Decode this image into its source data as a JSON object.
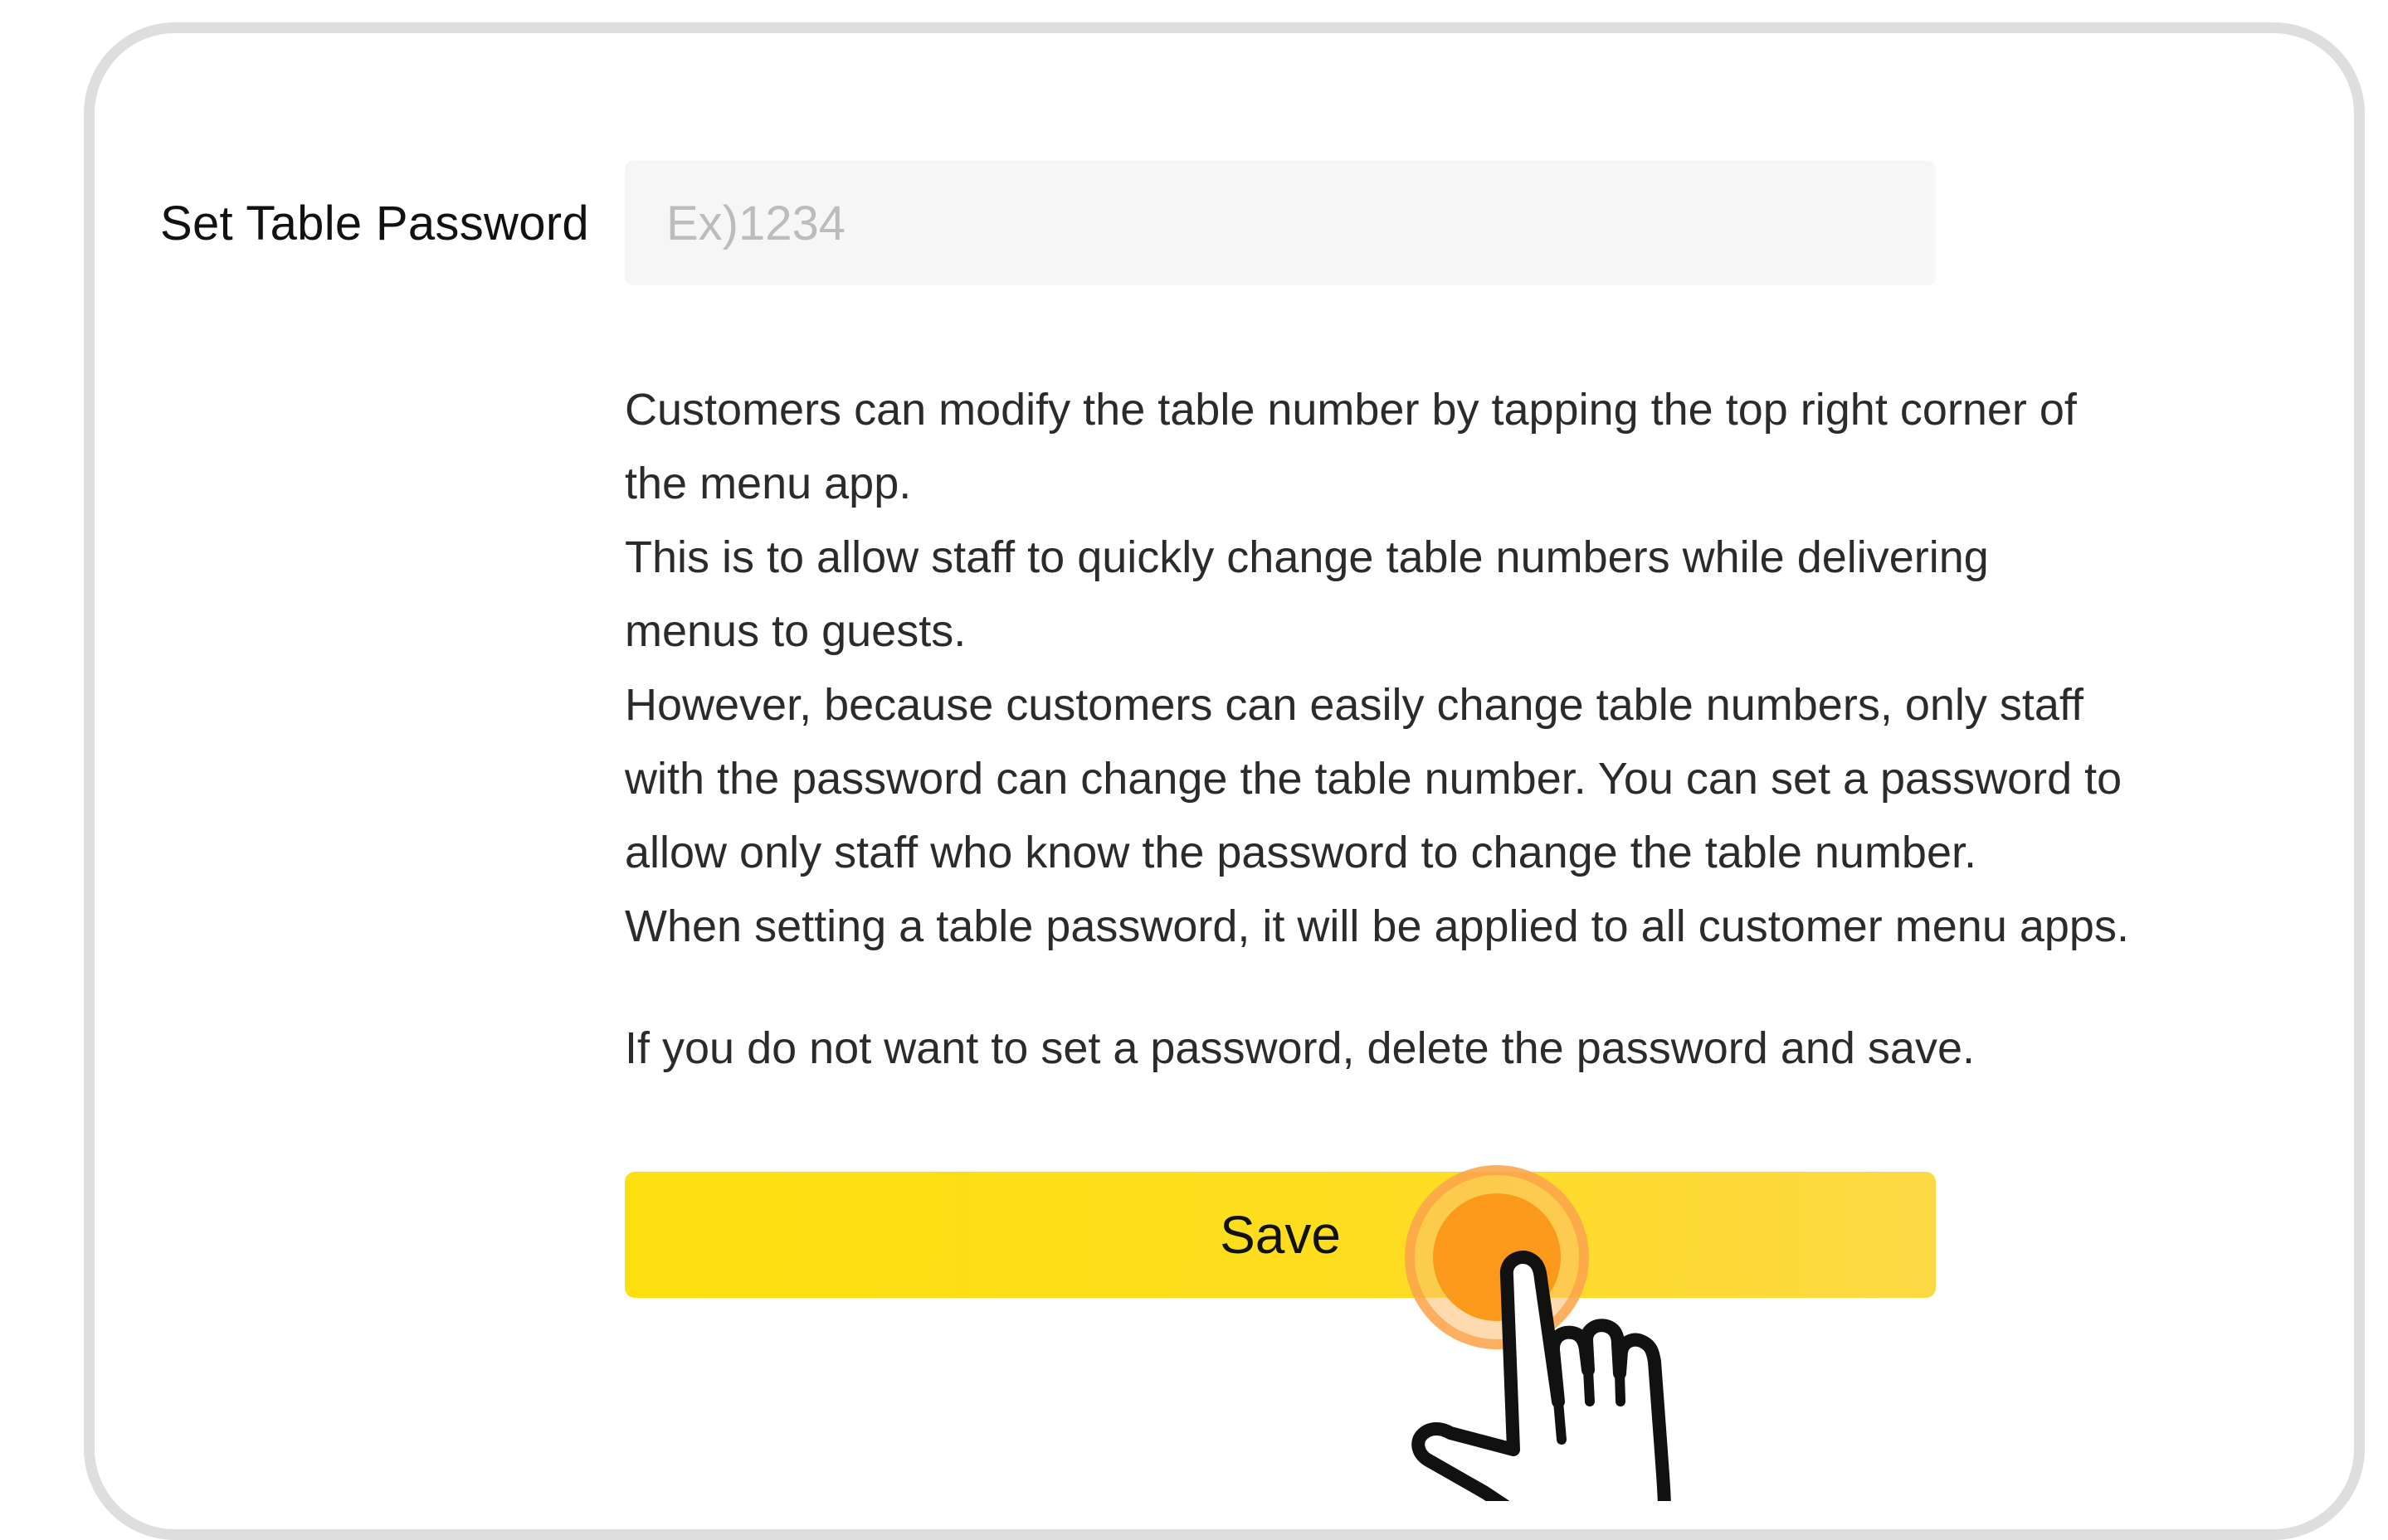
{
  "password_field": {
    "label": "Set Table Password",
    "placeholder": "Ex)1234",
    "value": ""
  },
  "description": {
    "lines": [
      "Customers can modify the table number by tapping the top right corner of",
      "the menu app.",
      "This is to allow staff to quickly change table numbers while delivering",
      "menus to guests.",
      "However, because customers can easily change table numbers, only staff",
      "with the password can change the table number. You can set a password to",
      "allow only staff who know the password to change the table number.",
      "When setting a table password, it will be applied to all customer menu apps."
    ],
    "note": "If you do not want to set a password, delete the password and save."
  },
  "save_button": {
    "label": "Save"
  },
  "colors": {
    "button_yellow": "#fde00f",
    "tap_orange": "#fb9a1a",
    "panel_border": "#dedede",
    "input_bg": "#f6f6f6"
  },
  "icons": {
    "pointer": "pointing-hand-icon",
    "tap": "tap-indicator-icon"
  }
}
